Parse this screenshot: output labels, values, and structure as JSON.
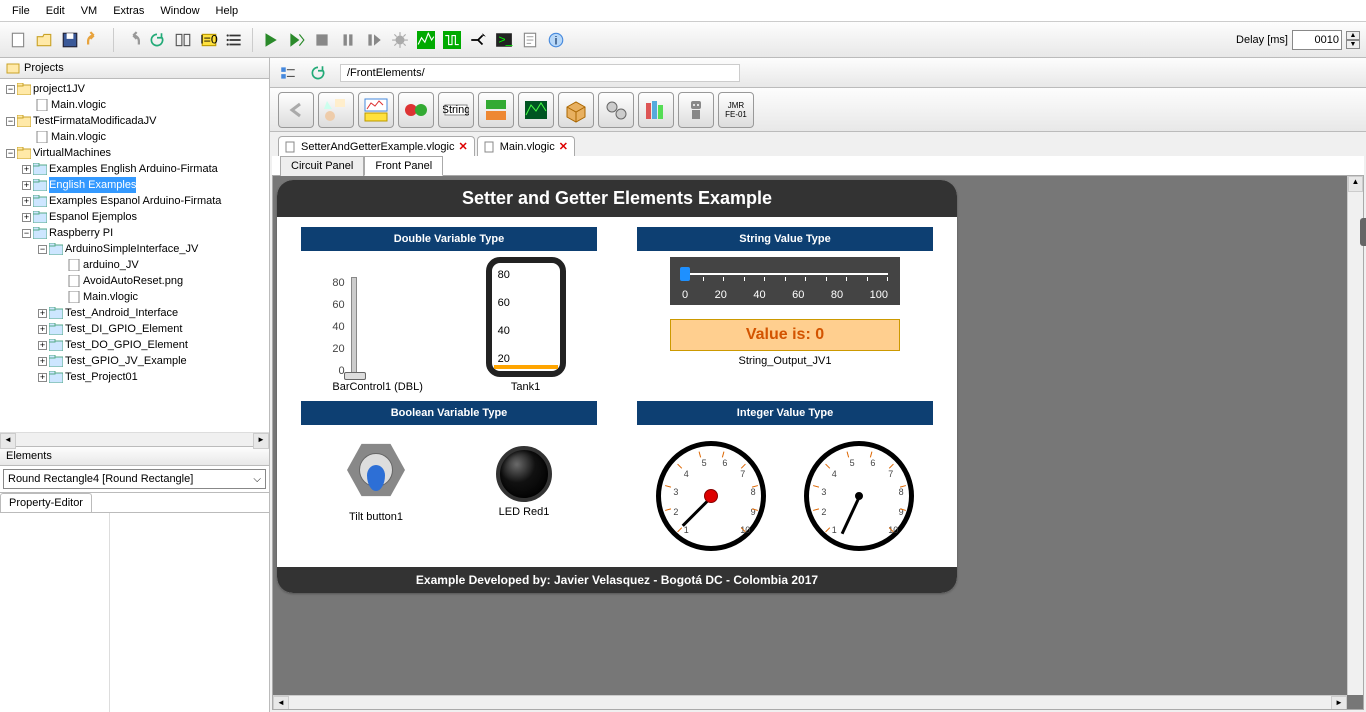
{
  "menu": [
    "File",
    "Edit",
    "VM",
    "Extras",
    "Window",
    "Help"
  ],
  "delay": {
    "label": "Delay [ms]",
    "value": "0010"
  },
  "projects_label": "Projects",
  "tree": [
    {
      "l": "project1JV",
      "t": "proj",
      "e": "-",
      "c": [
        {
          "l": "Main.vlogic",
          "t": "file"
        }
      ]
    },
    {
      "l": "TestFirmataModificadaJV",
      "t": "proj",
      "e": "-",
      "c": [
        {
          "l": "Main.vlogic",
          "t": "file"
        }
      ]
    },
    {
      "l": "VirtualMachines",
      "t": "proj",
      "e": "-",
      "c": [
        {
          "l": "Examples English Arduino-Firmata",
          "t": "folder",
          "e": "+"
        },
        {
          "l": "English Examples",
          "t": "folder",
          "e": "+",
          "sel": true
        },
        {
          "l": "Examples Espanol Arduino-Firmata",
          "t": "folder",
          "e": "+"
        },
        {
          "l": "Espanol Ejemplos",
          "t": "folder",
          "e": "+"
        },
        {
          "l": "Raspberry PI",
          "t": "folder",
          "e": "-",
          "c": [
            {
              "l": "ArduinoSimpleInterface_JV",
              "t": "folder",
              "e": "-",
              "c": [
                {
                  "l": "arduino_JV",
                  "t": "file"
                },
                {
                  "l": "AvoidAutoReset.png",
                  "t": "file"
                },
                {
                  "l": "Main.vlogic",
                  "t": "file"
                }
              ]
            },
            {
              "l": "Test_Android_Interface",
              "t": "folder",
              "e": "+"
            },
            {
              "l": "Test_DI_GPIO_Element",
              "t": "folder",
              "e": "+"
            },
            {
              "l": "Test_DO_GPIO_Element",
              "t": "folder",
              "e": "+"
            },
            {
              "l": "Test_GPIO_JV_Example",
              "t": "folder",
              "e": "+"
            },
            {
              "l": "Test_Project01",
              "t": "folder",
              "e": "+"
            }
          ]
        }
      ]
    }
  ],
  "elements_label": "Elements",
  "combo_value": "Round Rectangle4 [Round Rectangle]",
  "prop_tab": "Property-Editor",
  "breadcrumb": "/FrontElements/",
  "file_tabs": [
    {
      "label": "SetterAndGetterExample.vlogic"
    },
    {
      "label": "Main.vlogic"
    }
  ],
  "panel_tabs": {
    "circuit": "Circuit Panel",
    "front": "Front Panel"
  },
  "front": {
    "title": "Setter and Getter Elements Example",
    "footer": "Example Developed by: Javier Velasquez - Bogotá DC - Colombia 2017",
    "sections": {
      "double": "Double Variable Type",
      "string": "String Value Type",
      "bool": "Boolean Variable Type",
      "int": "Integer Value Type"
    },
    "bar_label": "BarControl1 (DBL)",
    "tank_label": "Tank1",
    "string_out_label": "String_Output_JV1",
    "value_is": "Value is: 0",
    "tilt_label": "Tilt button1",
    "led_label": "LED Red1",
    "vticks": [
      "80",
      "60",
      "40",
      "20",
      "0"
    ],
    "tank_ticks": [
      "80",
      "60",
      "40",
      "20"
    ],
    "hticks": [
      "0",
      "20",
      "40",
      "60",
      "80",
      "100"
    ],
    "gauge_nums": [
      "1",
      "2",
      "3",
      "4",
      "5",
      "6",
      "7",
      "8",
      "9",
      "10"
    ]
  },
  "palette_jmr": "JMR\nFE-01"
}
